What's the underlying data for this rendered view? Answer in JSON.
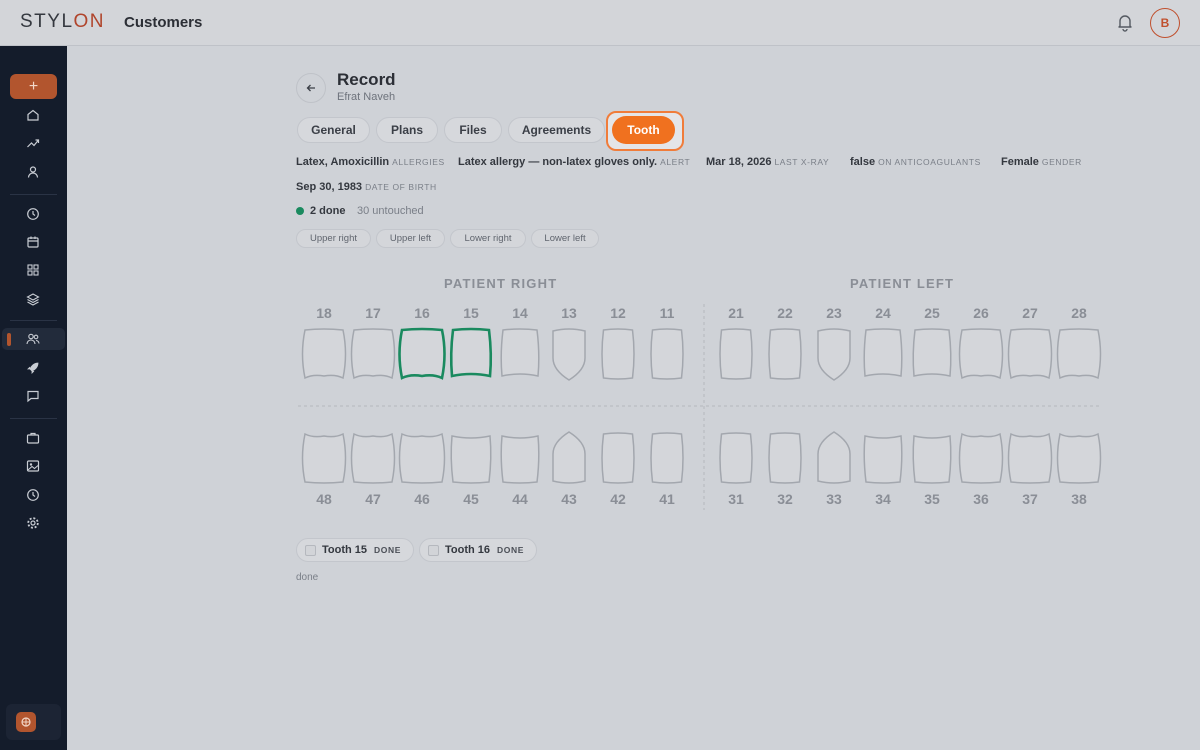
{
  "app": {
    "logo_prefix": "STYL",
    "logo_suffix": "ON",
    "page_title": "Customers",
    "avatar_initial": "B"
  },
  "record": {
    "title": "Record",
    "patient_name": "Efrat Naveh"
  },
  "tabs": [
    {
      "label": "General"
    },
    {
      "label": "Plans"
    },
    {
      "label": "Files"
    },
    {
      "label": "Agreements"
    },
    {
      "label": "Tooth",
      "active": true
    }
  ],
  "info": {
    "allergies": {
      "value": "Latex, Amoxicillin",
      "key": "ALLERGIES"
    },
    "alert": {
      "value": "Latex allergy — non-latex gloves only.",
      "key": "ALERT"
    },
    "xray": {
      "value": "Mar 18, 2026",
      "key": "LAST X-RAY"
    },
    "anticoag": {
      "value": "false",
      "key": "ON ANTICOAGULANTS"
    },
    "gender": {
      "value": "Female",
      "key": "GENDER"
    },
    "dob": {
      "value": "Sep 30, 1983",
      "key": "DATE OF BIRTH"
    }
  },
  "status": {
    "done": "2 done",
    "untouched": "30 untouched"
  },
  "quadrants": [
    "Upper right",
    "Upper left",
    "Lower right",
    "Lower left"
  ],
  "chart": {
    "patient_right": "PATIENT RIGHT",
    "patient_left": "PATIENT LEFT",
    "upper": [
      "18",
      "17",
      "16",
      "15",
      "14",
      "13",
      "12",
      "11",
      "21",
      "22",
      "23",
      "24",
      "25",
      "26",
      "27",
      "28"
    ],
    "lower": [
      "48",
      "47",
      "46",
      "45",
      "44",
      "43",
      "42",
      "41",
      "31",
      "32",
      "33",
      "34",
      "35",
      "36",
      "37",
      "38"
    ],
    "done_teeth": [
      "16",
      "15"
    ],
    "done_color": "#1a8a5f"
  },
  "tooth_chips": [
    {
      "label": "Tooth 15",
      "status": "DONE"
    },
    {
      "label": "Tooth 16",
      "status": "DONE"
    }
  ],
  "footer_text": "done",
  "colors": {
    "accent": "#f0711f",
    "sidebar": "#141c2b",
    "done": "#1a8a5f"
  }
}
